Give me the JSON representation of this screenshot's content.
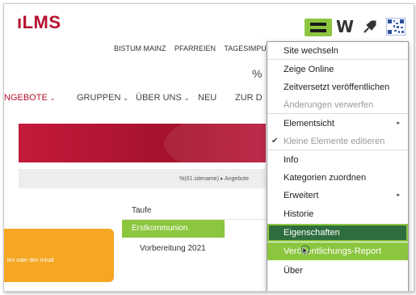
{
  "logo": {
    "text": "ıLMS"
  },
  "toolbar": {
    "menu_icon": "hamburger-icon",
    "w_label": "W",
    "pin_icon": "pin-icon",
    "qr_icon": "qr-code-icon",
    "accent_color": "#8cc63f"
  },
  "topnav": [
    "BISTUM MAINZ",
    "PFARREIEN",
    "TAGESIMPULS"
  ],
  "percent_text": "%",
  "mainnav": [
    {
      "label": "NGEBOTE",
      "chevron": "⌄"
    },
    {
      "label": "GRUPPEN",
      "chevron": "⌄"
    },
    {
      "label": "ÜBER UNS",
      "chevron": "⌄"
    },
    {
      "label": "NEU",
      "chevron": ""
    },
    {
      "label": "ZUR D",
      "chevron": ""
    }
  ],
  "breadcrumb": "%(01.sitename) ▸ Angebote",
  "subnav": {
    "taufe": "Taufe",
    "erstkommunion": "Erstkommunion",
    "vorbereitung": "Vorbereitung 2021"
  },
  "orange_box": {
    "text": "len oder den Inhalt"
  },
  "context_menu": {
    "items": [
      {
        "label": "Site wechseln",
        "state": "normal"
      },
      {
        "label": "Zeige Online",
        "state": "normal"
      },
      {
        "label": "Zeitversetzt veröffentlichen",
        "state": "normal"
      },
      {
        "label": "Änderungen verwerfen",
        "state": "disabled"
      },
      {
        "label": "Elementsicht",
        "state": "submenu"
      },
      {
        "label": "Kleine Elemente editieren",
        "state": "checked-disabled"
      },
      {
        "label": "Info",
        "state": "normal"
      },
      {
        "label": "Kategorien zuordnen",
        "state": "normal"
      },
      {
        "label": "Erweitert",
        "state": "submenu"
      },
      {
        "label": "Historie",
        "state": "normal"
      },
      {
        "label": "Eigenschaften",
        "state": "active"
      },
      {
        "label": "Veröffentlichungs-Report",
        "state": "highlight"
      },
      {
        "label": "Über",
        "state": "normal"
      }
    ],
    "checkmark": "✔",
    "submenu_arrow": "▸"
  },
  "colors": {
    "brand_red": "#b5122f",
    "accent_green": "#8cc63f",
    "active_green": "#2e6d3e",
    "orange": "#f5a623"
  }
}
